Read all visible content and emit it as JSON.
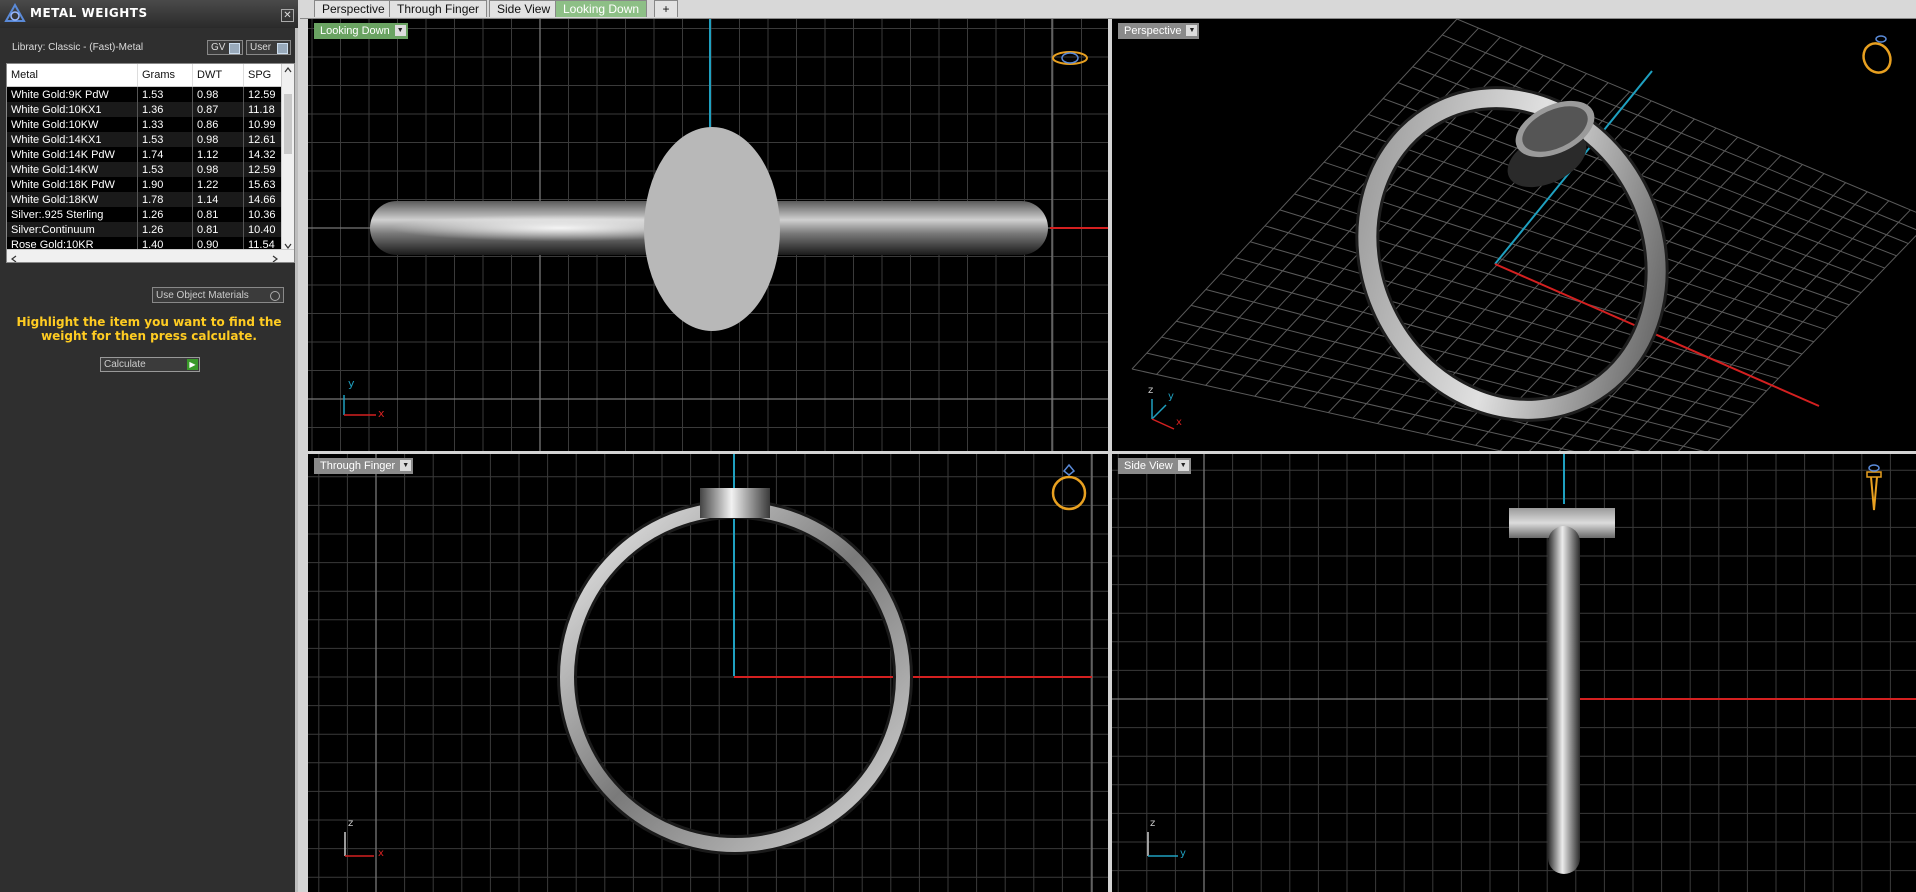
{
  "panel": {
    "title": "METAL WEIGHTS",
    "close_glyph": "✕",
    "library_label": "Library: Classic - (Fast)-Metal",
    "toggle_gv": "GV",
    "toggle_user": "User",
    "columns": [
      "Metal",
      "Grams",
      "DWT",
      "SPG"
    ],
    "rows": [
      [
        "White Gold:9K PdW",
        "1.53",
        "0.98",
        "12.59"
      ],
      [
        "White Gold:10KX1",
        "1.36",
        "0.87",
        "11.18"
      ],
      [
        "White Gold:10KW",
        "1.33",
        "0.86",
        "10.99"
      ],
      [
        "White Gold:14KX1",
        "1.53",
        "0.98",
        "12.61"
      ],
      [
        "White Gold:14K PdW",
        "1.74",
        "1.12",
        "14.32"
      ],
      [
        "White Gold:14KW",
        "1.53",
        "0.98",
        "12.59"
      ],
      [
        "White Gold:18K PdW",
        "1.90",
        "1.22",
        "15.63"
      ],
      [
        "White Gold:18KW",
        "1.78",
        "1.14",
        "14.66"
      ],
      [
        "Silver:.925 Sterling",
        "1.26",
        "0.81",
        "10.36"
      ],
      [
        "Silver:Continuum",
        "1.26",
        "0.81",
        "10.40"
      ],
      [
        "Rose Gold:10KR",
        "1.40",
        "0.90",
        "11.54"
      ]
    ],
    "use_object_materials": "Use Object Materials",
    "instructions": "Highlight the item you want to find the weight for then press calculate.",
    "calculate_label": "Calculate",
    "calculate_glyph": "▶"
  },
  "tabs": [
    {
      "label": "Perspective",
      "active": false
    },
    {
      "label": "Through Finger",
      "active": false
    },
    {
      "label": "Side View",
      "active": false
    },
    {
      "label": "Looking Down",
      "active": true
    }
  ],
  "add_tab_glyph": "+",
  "viewports": {
    "top_left": {
      "label": "Looking Down",
      "axis_a": "y",
      "axis_b": "x"
    },
    "top_right": {
      "label": "Perspective",
      "axis_a": "z",
      "axis_b": "y",
      "axis_c": "x"
    },
    "bottom_left": {
      "label": "Through Finger",
      "axis_a": "z",
      "axis_b": "x"
    },
    "bottom_right": {
      "label": "Side View",
      "axis_a": "z",
      "axis_b": "y"
    }
  },
  "dropdown_glyph": "▼",
  "colors": {
    "x_axis": "#d42020",
    "y_axis": "#1fa0c0",
    "icon_gold": "#e8a020",
    "grid": "#3a3a3a"
  }
}
